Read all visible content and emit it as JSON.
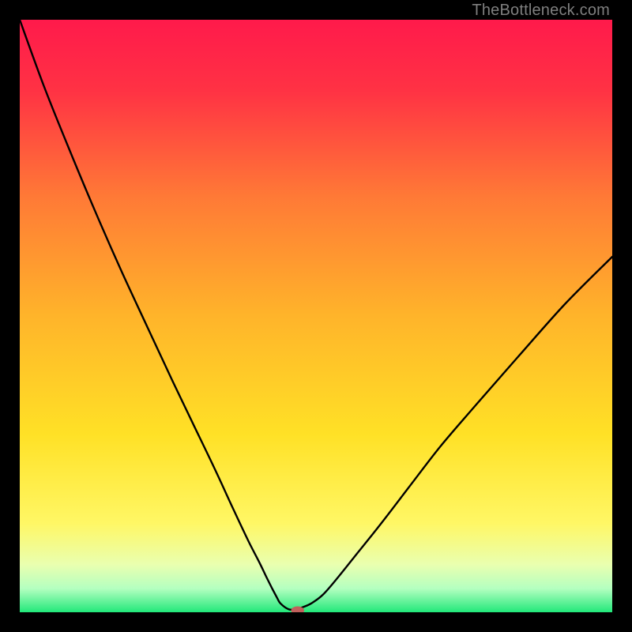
{
  "watermark": "TheBottleneck.com",
  "chart_data": {
    "type": "line",
    "title": "",
    "xlabel": "",
    "ylabel": "",
    "xlim": [
      0,
      100
    ],
    "ylim": [
      0,
      100
    ],
    "background_gradient": {
      "stops": [
        {
          "offset": 0.0,
          "color": "#ff1a4b"
        },
        {
          "offset": 0.12,
          "color": "#ff3244"
        },
        {
          "offset": 0.3,
          "color": "#ff7a36"
        },
        {
          "offset": 0.5,
          "color": "#ffb42a"
        },
        {
          "offset": 0.7,
          "color": "#ffe126"
        },
        {
          "offset": 0.85,
          "color": "#fff765"
        },
        {
          "offset": 0.92,
          "color": "#e9ffb0"
        },
        {
          "offset": 0.96,
          "color": "#b4ffc0"
        },
        {
          "offset": 1.0,
          "color": "#22e87a"
        }
      ]
    },
    "series": [
      {
        "name": "bottleneck-curve",
        "x": [
          0.0,
          4.0,
          8.0,
          12.8,
          17.2,
          21.6,
          25.8,
          29.4,
          33.0,
          36.0,
          38.6,
          40.4,
          41.6,
          42.6,
          43.4,
          44.0,
          45.4,
          46.6,
          47.6,
          49.2,
          51.2,
          53.8,
          57.0,
          61.0,
          65.6,
          71.0,
          77.0,
          84.0,
          92.0,
          100.0
        ],
        "y": [
          100.0,
          89.0,
          79.0,
          67.5,
          57.5,
          48.0,
          39.0,
          31.5,
          24.0,
          17.5,
          12.0,
          8.5,
          6.0,
          4.0,
          2.5,
          1.5,
          0.5,
          0.5,
          0.8,
          1.5,
          3.0,
          6.0,
          10.0,
          15.0,
          21.0,
          28.0,
          35.0,
          43.0,
          52.0,
          60.0
        ]
      }
    ],
    "flat_segment": {
      "x0": 44.0,
      "x1": 47.6,
      "y": 0.5
    },
    "marker": {
      "x": 46.9,
      "y": 0.3,
      "color": "#c1605c",
      "rx": 1.1,
      "ry": 0.7
    }
  }
}
